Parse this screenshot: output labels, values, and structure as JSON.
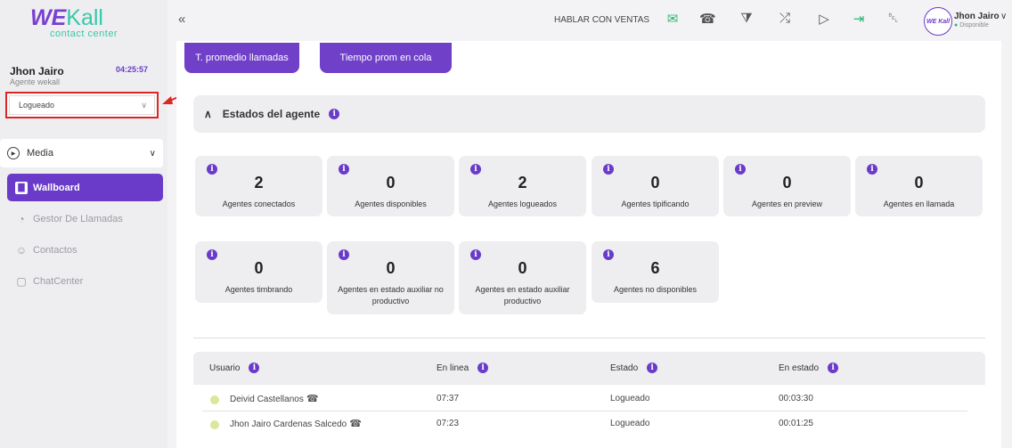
{
  "logo": {
    "brand_a": "WE",
    "brand_b": "Kall",
    "sub": "contact center"
  },
  "agent": {
    "name": "Jhon Jairo",
    "role": "Agente wekall",
    "timer": "04:25:57",
    "status": "Logueado"
  },
  "sidebar": {
    "media_label": "Media",
    "items": [
      {
        "label": "Wallboard",
        "icon": "bar-chart-icon"
      },
      {
        "label": "Gestor De Llamadas",
        "icon": "gauge-icon"
      },
      {
        "label": "Contactos",
        "icon": "add-user-icon"
      },
      {
        "label": "ChatCenter",
        "icon": "chat-icon"
      }
    ]
  },
  "header": {
    "sales": "HABLAR CON VENTAS",
    "icons": [
      "mail-icon",
      "phone-icon",
      "filter-icon",
      "shuffle-icon",
      "play-icon",
      "login-icon",
      "bell-icon"
    ],
    "user_name": "Jhon Jairo",
    "user_status": "Disponible",
    "avatar_text": "WE Kall"
  },
  "tabs": [
    "T. promedio llamadas",
    "Tiempo prom en cola"
  ],
  "section": {
    "title": "Estados del agente"
  },
  "cards": [
    {
      "value": "2",
      "label": "Agentes conectados"
    },
    {
      "value": "0",
      "label": "Agentes disponibles"
    },
    {
      "value": "2",
      "label": "Agentes logueados"
    },
    {
      "value": "0",
      "label": "Agentes tipificando"
    },
    {
      "value": "0",
      "label": "Agentes en preview"
    },
    {
      "value": "0",
      "label": "Agentes en llamada"
    },
    {
      "value": "0",
      "label": "Agentes timbrando"
    },
    {
      "value": "0",
      "label": "Agentes en estado auxiliar no productivo"
    },
    {
      "value": "0",
      "label": "Agentes en estado auxiliar productivo"
    },
    {
      "value": "6",
      "label": "Agentes no disponibles"
    }
  ],
  "table": {
    "headers": [
      "Usuario",
      "En linea",
      "Estado",
      "En estado"
    ],
    "rows": [
      {
        "user": "Deivid Castellanos",
        "online": "07:37",
        "state": "Logueado",
        "in_state": "00:03:30"
      },
      {
        "user": "Jhon Jairo Cardenas Salcedo",
        "online": "07:23",
        "state": "Logueado",
        "in_state": "00:01:25"
      }
    ]
  },
  "colors": {
    "accent": "#6a3bc9",
    "brand_green": "#37c8a8",
    "highlight": "#e02424"
  }
}
